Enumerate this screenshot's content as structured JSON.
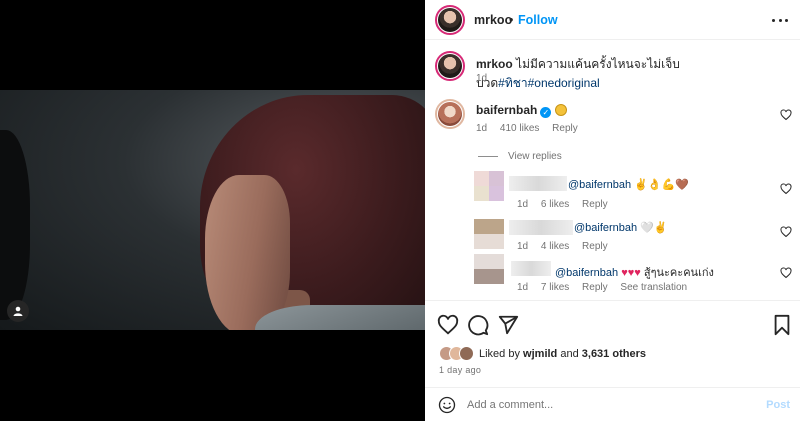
{
  "post": {
    "username": "mrkoo",
    "separator": "•",
    "follow_label": "Follow",
    "caption_user": "mrkoo",
    "caption_text": "ไม่มีความแค้นครั้งไหนจะไม่เจ็บปวด",
    "caption_hashtags": "#ทิชา#onedoriginal",
    "caption_time": "1d"
  },
  "comment": {
    "username": "baifernbah",
    "time": "1d",
    "likes": "410 likes",
    "reply_label": "Reply",
    "view_replies": "View replies"
  },
  "replies": [
    {
      "mention": "@baifernbah",
      "emoji": "✌👌💪🤎",
      "time": "1d",
      "likes": "6 likes",
      "reply_label": "Reply"
    },
    {
      "mention": "@baifernbah",
      "emoji": "🤍✌",
      "time": "1d",
      "likes": "4 likes",
      "reply_label": "Reply"
    },
    {
      "mention": "@baifernbah",
      "emoji": "♥♥♥",
      "text": "สู้ๆนะคะคนเก่ง",
      "time": "1d",
      "likes": "7 likes",
      "reply_label": "Reply",
      "see_translation": "See translation"
    }
  ],
  "engagement": {
    "liked_by_prefix": "Liked by",
    "liked_by_user": "wjmild",
    "liked_by_and": "and",
    "liked_by_others": "3,631 others",
    "posted_ago": "1 day ago"
  },
  "comment_box": {
    "placeholder": "Add a comment...",
    "post_label": "Post"
  },
  "icons": {
    "like": "heart-icon",
    "comment": "comment-icon",
    "share": "share-icon",
    "save": "bookmark-icon",
    "emoji": "emoji-icon",
    "more": "more-icon",
    "tag": "user-tag-icon"
  },
  "colors": {
    "link_blue": "#0095f6",
    "hashtag": "#00376b",
    "muted": "#737373",
    "heart_red": "#e0245e"
  }
}
